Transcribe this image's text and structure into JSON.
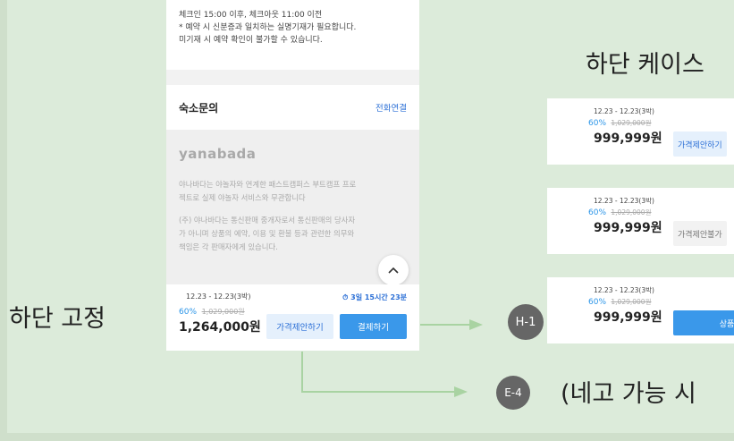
{
  "phone": {
    "policy_lines": [
      "체크인 15:00 이후, 체크아웃 11:00 이전",
      "* 예약 시 신분증과 일치하는 실명기재가 필요합니다.",
      "미기재 시 예약 확인이 불가할 수 있습니다."
    ],
    "inquiry_title": "숙소문의",
    "inquiry_link": "전화연결",
    "logo": "yanabada",
    "footer_text_1": [
      "야나바다는 야놀자와 연계한 패스트캠퍼스 부트캠프 프로",
      "젝트로 실제 야놀자 서비스와 무관합니다"
    ],
    "footer_text_2": [
      "(주) 야나바다는 통신판매 중개자로서 통신판매의 당사자",
      "가 아니며 상품의 예약, 이용 및 환불 등과 관련한 의무와",
      "책임은 각 판매자에게 있습니다."
    ],
    "top_button_icon": "chevron-up-icon",
    "bar": {
      "date": "12.23 - 12.23(3박)",
      "timer": "3일 15시간 23분",
      "discount": "60%",
      "original_price": "1,029,000원",
      "price": "1,264,000원",
      "offer_label": "가격제안하기",
      "pay_label": "결제하기"
    }
  },
  "labels": {
    "fixed": "하단 고정",
    "case_heading": "하단 케이스",
    "bottom_note": "(네고 가능 시"
  },
  "markers": {
    "m1": "H-1",
    "m2": "E-4"
  },
  "cards": [
    {
      "date": "12.23 - 12.23(3박)",
      "discount": "60%",
      "original_price": "1,029,000원",
      "price": "999,999원",
      "button": "가격제안하기"
    },
    {
      "date": "12.23 - 12.23(3박)",
      "discount": "60%",
      "original_price": "1,029,000원",
      "price": "999,999원",
      "button": "가격제안불가"
    },
    {
      "date": "12.23 - 12.23(3박)",
      "discount": "60%",
      "original_price": "1,029,000원",
      "price": "999,999원",
      "button": "상품"
    }
  ],
  "colors": {
    "accent": "#3a98ea",
    "link": "#2b6fd6",
    "background": "#dcebda",
    "marker": "#666666"
  }
}
